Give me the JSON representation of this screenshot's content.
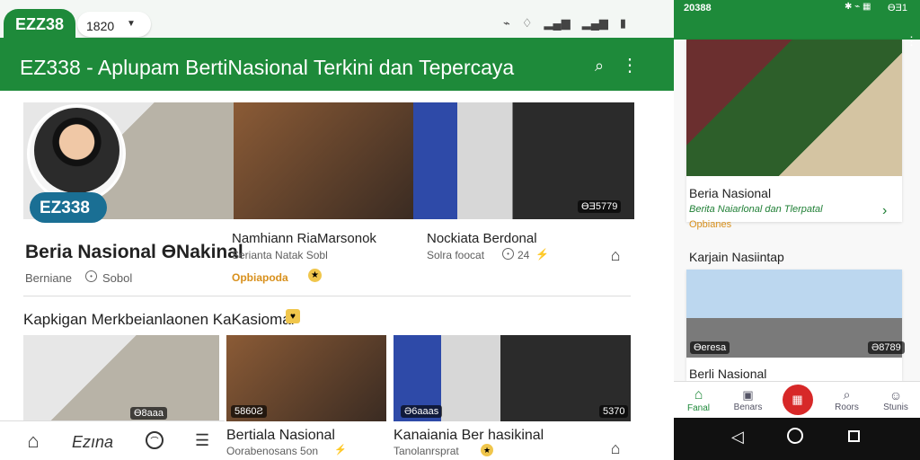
{
  "left": {
    "top_bar": {
      "brand": "EZZ38",
      "time": "1820",
      "status_icons": [
        "wifi-icon",
        "bluetooth-icon",
        "signal-icon",
        "signal-icon",
        "battery-icon"
      ]
    },
    "app_bar": {
      "title": "EZ338 - Aplupam BertiNasional Terkini dan Tepercaya"
    },
    "hero": {
      "logo_text": "EZ338",
      "title": "Beria Nasional ƟNakinal",
      "meta_left": "Berniane",
      "meta_clock_label": "Sobol",
      "middle_headline": "Namhiann RiaMarsonok",
      "middle_sub": "Serianta Natak Sobl",
      "middle_link": "Opbiapoda",
      "right_headline": "Nockiata Berdonal",
      "right_sub": "Solra foocat",
      "right_count": "24",
      "right_badge": "ƟƎ5779"
    },
    "section": {
      "title": "Kapkigan Merkbeianlaonen KaKasiomal"
    },
    "grid": [
      {
        "badge": "Ɵ8aaa"
      },
      {
        "badge": "5860Ƨ",
        "headline": "Bertiala Nasional",
        "sub": "Oorabenosans 5on"
      },
      {
        "badge": "Ə6aaas",
        "headline": "Kanaiania Ber hasikinal",
        "sub": "Tanolanrsprat"
      },
      {
        "badge": "5370"
      }
    ],
    "bottom_nav": {
      "items": [
        {
          "icon": "home-icon",
          "label": ""
        },
        {
          "icon": "text-icon",
          "label": "Ezına"
        },
        {
          "icon": "circle-icon",
          "label": ""
        },
        {
          "icon": "menu-icon",
          "label": ""
        }
      ]
    }
  },
  "right": {
    "status": {
      "time": "20388",
      "right": "ƟƎ1"
    },
    "card1": {
      "title": "Beria Nasional",
      "subtitle": "Berita Naiarlonal dan Tlerpatal",
      "meta": "Opbianes"
    },
    "section2": {
      "title": "Karjain Nasiintap"
    },
    "card2": {
      "title": "Berli Nasional",
      "badge_left": "Ɵeresa",
      "badge_right": "Ə8789"
    },
    "bottom_nav": {
      "items": [
        {
          "icon": "home-icon",
          "label": "Fanal"
        },
        {
          "icon": "news-icon",
          "label": "Benars"
        },
        {
          "icon": "red-badge-icon",
          "label": ""
        },
        {
          "icon": "search-icon",
          "label": "Roors"
        },
        {
          "icon": "profile-icon",
          "label": "Stunis"
        }
      ]
    },
    "system_nav": [
      {
        "icon": "back-icon"
      },
      {
        "icon": "home-circle-icon"
      },
      {
        "icon": "recent-apps-icon"
      }
    ]
  }
}
